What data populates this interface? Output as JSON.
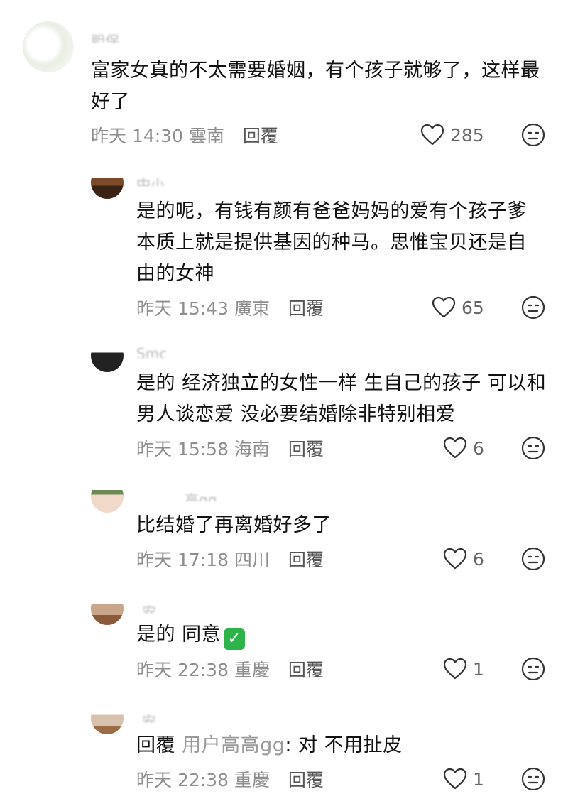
{
  "comments": [
    {
      "username": "胆保",
      "text_lines": [
        "富家女真的不太需要婚姻，有个孩子就够了，这样最",
        "好了"
      ],
      "time": "昨天 14:30",
      "location": "雲南",
      "reply_label": "回覆",
      "likes": "285"
    },
    {
      "username": "中小",
      "text_lines": [
        "是的呢，有钱有颜有爸爸妈妈的爱有个孩子爹",
        "本质上就是提供基因的种马。思惟宝贝还是自",
        "由的女神"
      ],
      "time": "昨天 15:43",
      "location": "廣東",
      "reply_label": "回覆",
      "likes": "65"
    },
    {
      "username": "Smc",
      "text_lines": [
        "是的 经济独立的女性一样 生自己的孩子 可以和",
        "男人谈恋爱 没必要结婚除非特别相爱"
      ],
      "time": "昨天 15:58",
      "location": "海南",
      "reply_label": "回覆",
      "likes": "6"
    },
    {
      "username": "高gg",
      "text_lines": [
        "比结婚了再离婚好多了"
      ],
      "time": "昨天 17:18",
      "location": "四川",
      "reply_label": "回覆",
      "likes": "6"
    },
    {
      "username": "安",
      "text_lines": [
        "是的 同意"
      ],
      "time": "昨天 22:38",
      "location": "重慶",
      "reply_label": "回覆",
      "likes": "1"
    },
    {
      "username": "安",
      "reply_prefix": "回覆",
      "mention": "用户高高gg",
      "text": ": 对 不用扯皮",
      "time": "昨天 22:38",
      "location": "重慶",
      "reply_label": "回覆",
      "likes": "1"
    }
  ],
  "icons": {
    "like": "heart-outline-icon",
    "dislike": "neutral-face-icon",
    "check": "green-check-emoji"
  }
}
